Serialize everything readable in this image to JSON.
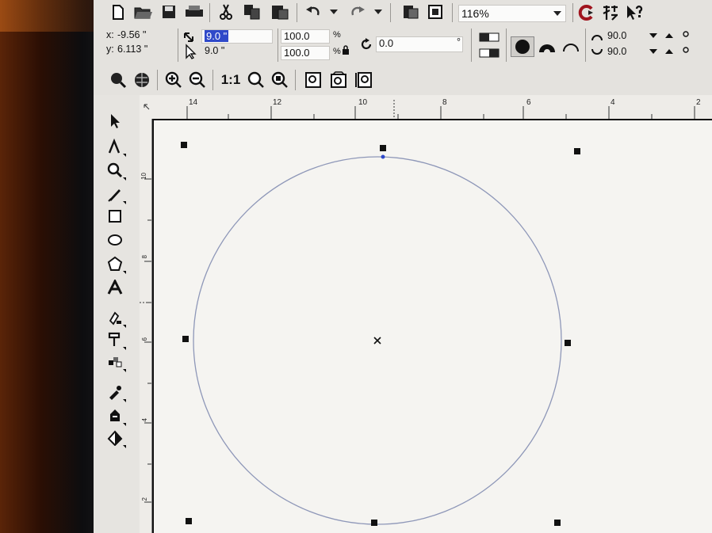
{
  "standard_toolbar": {
    "zoom_value": "116%",
    "buttons": [
      "new-icon",
      "open-icon",
      "save-icon",
      "print-icon",
      "cut-icon",
      "copy-icon",
      "paste-icon",
      "undo-icon",
      "redo-icon",
      "import-icon",
      "export-icon",
      "app-launcher-icon",
      "whats-this-icon"
    ]
  },
  "property_bar": {
    "x_label": "x:",
    "x_value": "-9.56 \"",
    "y_label": "y:",
    "y_value": "6.113 \"",
    "width_value": "9.0 \"",
    "height_value": "9.0 \"",
    "scale_x": "100.0",
    "scale_y": "100.0",
    "scale_unit": "%",
    "rotation_value": "0.0",
    "rotation_unit": "°",
    "start_angle": "90.0",
    "end_angle": "90.0"
  },
  "view_toolbar": {
    "one_to_one_label": "1:1"
  },
  "horizontal_ruler": {
    "labels": [
      "14",
      "12",
      "10",
      "8",
      "6",
      "4",
      "2"
    ]
  },
  "vertical_ruler": {
    "labels": [
      "10",
      "8",
      "6",
      "4",
      "2"
    ]
  },
  "toolbox": {
    "tools": [
      "pick-tool-icon",
      "shape-tool-icon",
      "zoom-tool-icon",
      "freehand-tool-icon",
      "rectangle-tool-icon",
      "ellipse-tool-icon",
      "polygon-tool-icon",
      "text-tool-icon",
      "interactive-blend-icon",
      "eyedropper-tool-icon",
      "interactive-fill-icon",
      "outline-tool-icon",
      "fill-tool-icon",
      "interactive-transparency-icon"
    ]
  },
  "colors": {
    "selection_highlight": "#2f49c9",
    "circle_outline": "#8e97b8"
  }
}
